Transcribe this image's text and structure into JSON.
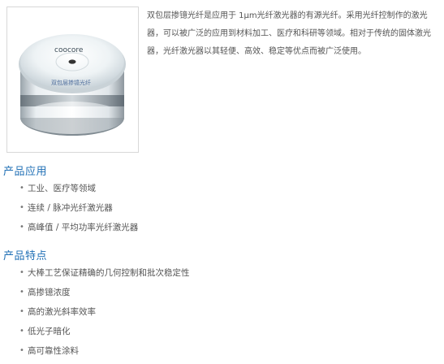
{
  "product": {
    "image_brand": "coocore",
    "image_label": "双包层掺镱光纤",
    "intro": "双包层掺镱光纤是应用于 1μm光纤激光器的有源光纤。采用光纤控制作的激光器，可以被广泛的应用到材料加工、医疗和科研等领域。相对于传统的固体激光器，光纤激光器以其轻便、高效、稳定等优点而被广泛使用。"
  },
  "applications": {
    "title": "产品应用",
    "items": [
      "工业、医疗等领域",
      "连续 / 脉冲光纤激光器",
      "高峰值 / 平均功率光纤激光器"
    ]
  },
  "features": {
    "title": "产品特点",
    "items": [
      "大棒工艺保证精确的几何控制和批次稳定性",
      "高掺镱浓度",
      "高的激光斜率效率",
      "低光子暗化",
      "高可靠性涂料"
    ]
  },
  "bullet": "•",
  "colors": {
    "heading": "#1f6fb5",
    "text": "#555555",
    "frame_border": "#d8d8d8"
  }
}
